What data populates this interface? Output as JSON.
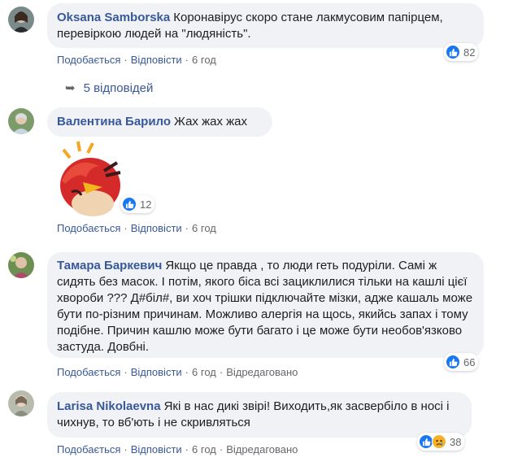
{
  "comments": [
    {
      "author": "Oksana Samborska",
      "text": "Коронавірус скоро стане лакмусовим папірцем, перевіркою людей на \"людяність\".",
      "like_label": "Подобається",
      "reply_label": "Відповісти",
      "time": "6 год",
      "reactions": "82",
      "replies_label": "5 відповідей"
    },
    {
      "author": "Валентина Барило",
      "text": "Жах жах жах",
      "like_label": "Подобається",
      "reply_label": "Відповісти",
      "time": "6 год",
      "reactions": "12"
    },
    {
      "author": "Тамара Баркевич",
      "text": "Якщо це правда , то люди геть подуріли. Самі ж сидять без масок. І потім, якого біса всі зациклилися тільки на кашлі цієї хвороби ??? Д#біл#, ви хоч трішки підключайте мізки, адже кашаль може бути по-різним причинам. Можливо алергія на щось, якийсь запах і тому подібне. Причин кашлю може бути багато і це може бути необов'язково застуда. Довбні.",
      "like_label": "Подобається",
      "reply_label": "Відповісти",
      "time": "6 год",
      "edited": "Відредаговано",
      "reactions": "66"
    },
    {
      "author": "Larisa Nikolaevna",
      "text": "Які в нас дикі звірі! Виходить,як засвербіло в носі і чихнув, то вб'ють і не скривляться",
      "like_label": "Подобається",
      "reply_label": "Відповісти",
      "time": "6 год",
      "edited": "Відредаговано",
      "reactions": "38"
    }
  ],
  "colors": {
    "link": "#385898",
    "bubble": "#f0f2f5",
    "like": "#1877f2",
    "meta": "#65676b"
  }
}
